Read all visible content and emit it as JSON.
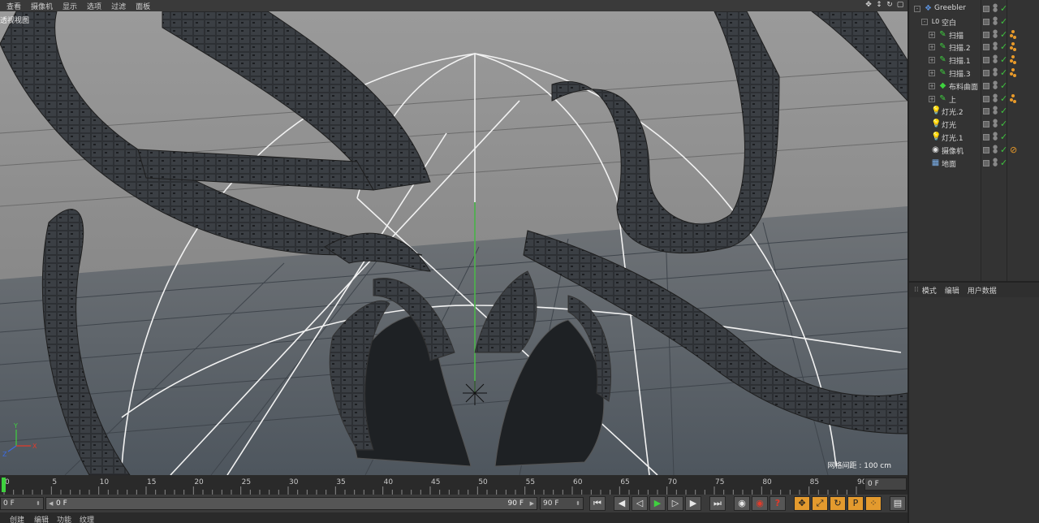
{
  "viewport": {
    "menu": [
      "查看",
      "摄像机",
      "显示",
      "选项",
      "过滤",
      "面板"
    ],
    "label": "透视视图",
    "grid_spacing": "网格间距 : 100 cm",
    "nav_icons": [
      "move-view-icon",
      "zoom-view-icon",
      "rotate-view-icon",
      "maximize-view-icon"
    ]
  },
  "object_manager": {
    "items": [
      {
        "name": "Greebler",
        "icon": "greebler-icon",
        "depth": 0,
        "expand": "-",
        "tags": 0
      },
      {
        "name": "空白",
        "icon": "null-icon",
        "depth": 1,
        "expand": "-",
        "tags": 0
      },
      {
        "name": "扫描",
        "icon": "sweep-icon",
        "depth": 2,
        "expand": "+",
        "tags": 3
      },
      {
        "name": "扫描.2",
        "icon": "sweep-icon",
        "depth": 2,
        "expand": "+",
        "tags": 3
      },
      {
        "name": "扫描.1",
        "icon": "sweep-icon",
        "depth": 2,
        "expand": "+",
        "tags": 3
      },
      {
        "name": "扫描.3",
        "icon": "sweep-icon",
        "depth": 2,
        "expand": "+",
        "tags": 3
      },
      {
        "name": "布料曲面",
        "icon": "cloth-surface-icon",
        "depth": 2,
        "expand": "+",
        "tags": 0
      },
      {
        "name": "上",
        "icon": "sweep-icon",
        "depth": 2,
        "expand": "+",
        "tags": 3
      },
      {
        "name": "灯光.2",
        "icon": "light-icon",
        "depth": 1,
        "expand": "",
        "tags": 0
      },
      {
        "name": "灯光",
        "icon": "light-icon",
        "depth": 1,
        "expand": "",
        "tags": 0
      },
      {
        "name": "灯光.1",
        "icon": "light-icon",
        "depth": 1,
        "expand": "",
        "tags": 0
      },
      {
        "name": "摄像机",
        "icon": "camera-icon",
        "depth": 1,
        "expand": "",
        "tags": 1
      },
      {
        "name": "地面",
        "icon": "floor-icon",
        "depth": 1,
        "expand": "",
        "tags": 0
      }
    ]
  },
  "attributes": {
    "tabs": [
      "模式",
      "编辑",
      "用户数据"
    ]
  },
  "timeline": {
    "ticks": [
      "0",
      "5",
      "10",
      "15",
      "20",
      "25",
      "30",
      "35",
      "40",
      "45",
      "50",
      "55",
      "60",
      "65",
      "70",
      "75",
      "80",
      "85",
      "90"
    ],
    "current_frame": 0,
    "end_field": "0 F"
  },
  "transport": {
    "current": "0 F",
    "range_start": "0 F",
    "range_end": "90 F",
    "end_frame": "90 F",
    "buttons": [
      {
        "name": "go-to-start-button",
        "glyph": "⏮"
      },
      {
        "name": "prev-key-button",
        "glyph": "◀"
      },
      {
        "name": "prev-frame-button",
        "glyph": "◁"
      },
      {
        "name": "play-button",
        "glyph": "▶"
      },
      {
        "name": "next-frame-button",
        "glyph": "▷"
      },
      {
        "name": "next-key-button",
        "glyph": "▶"
      },
      {
        "name": "go-to-end-button",
        "glyph": "⏭"
      },
      {
        "name": "record-keys-button",
        "glyph": "◉"
      },
      {
        "name": "autokey-button",
        "glyph": "◉"
      },
      {
        "name": "keyframe-selection-button",
        "glyph": "?"
      },
      {
        "name": "position-key-button",
        "glyph": "✥"
      },
      {
        "name": "scale-key-button",
        "glyph": "⤢"
      },
      {
        "name": "rotation-key-button",
        "glyph": "↻"
      },
      {
        "name": "parameter-key-button",
        "glyph": "P"
      },
      {
        "name": "pla-key-button",
        "glyph": "⁘"
      },
      {
        "name": "timeline-button",
        "glyph": "▤"
      }
    ]
  },
  "bottom_tabs": [
    "创建",
    "编辑",
    "功能",
    "纹理"
  ],
  "colors": {
    "accent_orange": "#e39a2e",
    "check_green": "#3fc23f",
    "tag_orange": "#e89a2a"
  }
}
